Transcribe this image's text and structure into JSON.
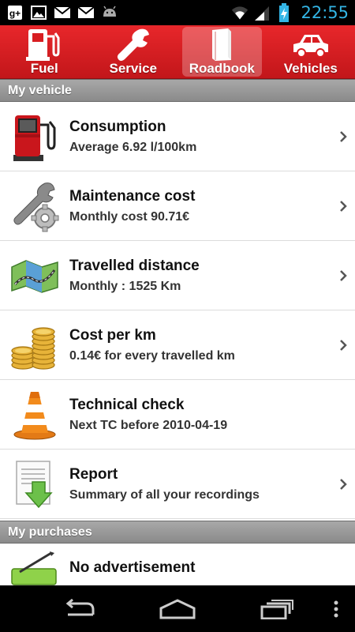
{
  "status_bar": {
    "time": "22:55",
    "left_icons": [
      "google-plus-icon",
      "image-icon",
      "gmail-icon",
      "gmail-icon",
      "android-icon"
    ],
    "right_icons": [
      "wifi-icon",
      "signal-icon",
      "battery-charging-icon"
    ]
  },
  "tabs": [
    {
      "label": "Fuel",
      "icon": "fuel-pump-icon",
      "active": false
    },
    {
      "label": "Service",
      "icon": "wrench-icon",
      "active": false
    },
    {
      "label": "Roadbook",
      "icon": "book-icon",
      "active": true
    },
    {
      "label": "Vehicles",
      "icon": "car-icon",
      "active": false
    }
  ],
  "sections": {
    "my_vehicle": "My vehicle",
    "my_purchases": "My purchases"
  },
  "vehicle_items": [
    {
      "title": "Consumption",
      "subtitle": "Average 6.92 l/100km",
      "icon": "fuel-pump-icon",
      "chevron": true
    },
    {
      "title": "Maintenance cost",
      "subtitle": "Monthly cost 90.71€",
      "icon": "wrench-gear-icon",
      "chevron": true
    },
    {
      "title": "Travelled distance",
      "subtitle": "Monthly : 1525 Km",
      "icon": "map-icon",
      "chevron": true
    },
    {
      "title": "Cost per km",
      "subtitle": "0.14€ for every travelled km",
      "icon": "coins-icon",
      "chevron": true
    },
    {
      "title": "Technical check",
      "subtitle": "Next TC before 2010-04-19",
      "icon": "traffic-cone-icon",
      "chevron": false
    },
    {
      "title": "Report",
      "subtitle": "Summary of all your recordings",
      "icon": "report-download-icon",
      "chevron": true
    }
  ],
  "purchase_items": [
    {
      "title": "No advertisement",
      "icon": "pencil-bar-icon"
    }
  ],
  "colors": {
    "tab_bar": "#d81e22",
    "section_header": "#999999",
    "clock": "#33b5e5"
  },
  "nav_bar": {
    "buttons": [
      "back-icon",
      "home-icon",
      "recent-apps-icon",
      "menu-icon"
    ]
  }
}
